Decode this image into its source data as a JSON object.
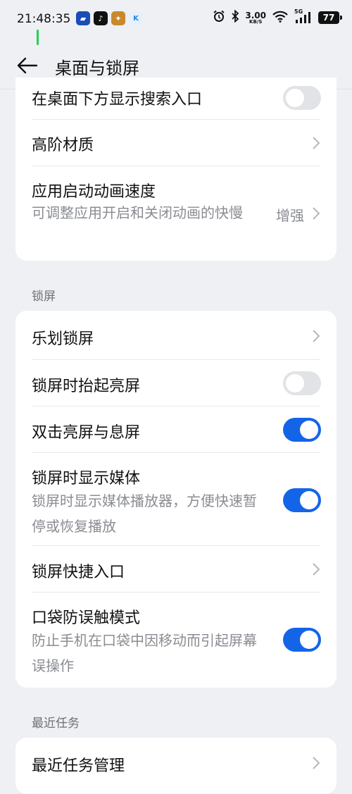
{
  "status_bar": {
    "time": "21:48:35",
    "net_speed_value": "3.00",
    "net_speed_unit": "KB/S",
    "network_type": "5G",
    "battery": "77"
  },
  "header": {
    "title": "桌面与锁屏"
  },
  "desktop_card": {
    "search_entry": {
      "title": "在桌面下方显示搜索入口",
      "toggle": "off"
    },
    "advanced_material": {
      "title": "高阶材质"
    },
    "animation_speed": {
      "title": "应用启动动画速度",
      "subtitle": "可调整应用开启和关闭动画的快慢",
      "value": "增强"
    }
  },
  "lock_section": {
    "label": "锁屏",
    "lehua_lock": {
      "title": "乐划锁屏"
    },
    "raise_to_wake": {
      "title": "锁屏时抬起亮屏",
      "toggle": "off"
    },
    "double_tap": {
      "title": "双击亮屏与息屏",
      "toggle": "on"
    },
    "show_media": {
      "title": "锁屏时显示媒体",
      "subtitle": "锁屏时显示媒体播放器，方便快速暂停或恢复播放",
      "toggle": "on"
    },
    "shortcut_entry": {
      "title": "锁屏快捷入口"
    },
    "pocket_mode": {
      "title": "口袋防误触模式",
      "subtitle": "防止手机在口袋中因移动而引起屏幕误操作",
      "toggle": "on"
    }
  },
  "recent_section": {
    "label": "最近任务",
    "recent_manage": {
      "title": "最近任务管理"
    }
  },
  "colors": {
    "accent": "#1464e8",
    "background": "#eef0f4",
    "card": "#ffffff",
    "secondary_text": "#8a8c92"
  }
}
